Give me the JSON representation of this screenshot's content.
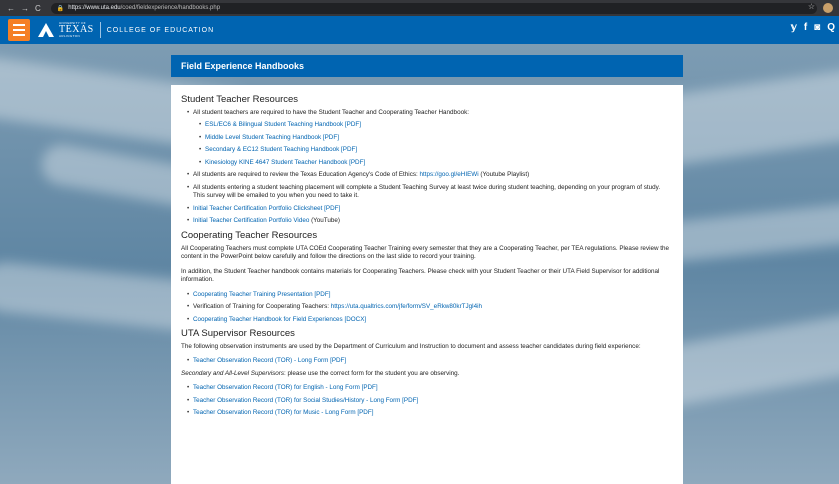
{
  "browser": {
    "url_host": "https://www.uta.edu",
    "url_path": "/coed/fieldexperience/handbooks.php"
  },
  "header": {
    "logo_university": "UNIVERSITY OF",
    "logo_texas": "TEXAS",
    "logo_arlington": "ARLINGTON",
    "college": "COLLEGE OF EDUCATION",
    "accent_color": "#0064b1",
    "menu_color": "#f58025",
    "social_icons": [
      "twitter-icon",
      "facebook-icon",
      "instagram-icon",
      "search-icon"
    ]
  },
  "page": {
    "title": "Field Experience Handbooks"
  },
  "student": {
    "heading": "Student Teacher Resources",
    "intro": "All student teachers are required to have the Student Teacher and Cooperating Teacher Handbook:",
    "handbooks": [
      "ESL/EC6 & Bilingual Student Teaching Handbook [PDF]",
      "Middle Level Student Teaching Handbook [PDF]",
      "Secondary & EC12 Student Teaching Handbook [PDF]",
      "Kinesiology KINE 4647 Student Teacher Handbook [PDF]"
    ],
    "ethics_text": "All students are required to review the Texas Education Agency's Code of Ethics: ",
    "ethics_link": "https://goo.gl/eHIEWi",
    "ethics_suffix": " (Youtube Playlist)",
    "survey_text": "All students entering a student teaching placement will complete a Student Teaching Survey at least twice during student teaching, depending on your program of study. This survey will be emailed to you when you need to take it.",
    "clicksheet": "Initial Teacher Certification Portfolio Clicksheet [PDF]",
    "video_link": "Initial Teacher Certification Portfolio Video",
    "video_suffix": " (YouTube)"
  },
  "cooperating": {
    "heading": "Cooperating Teacher Resources",
    "para1": "All Cooperating Teachers must complete UTA COEd Cooperating Teacher Training every semester that they are a Cooperating Teacher, per TEA regulations. Please review the content in the PowerPoint below carefully and follow the directions on the last slide to record your training.",
    "para2": "In addition, the Student Teacher handbook contains materials for Cooperating Teachers. Please check with your Student Teacher or their UTA Field Supervisor for additional information.",
    "presentation": "Cooperating Teacher Training Presentation [PDF]",
    "verification_text": "Verification of Training for Cooperating Teachers: ",
    "verification_link": "https://uta.qualtrics.com/jfe/form/SV_eRkw80krTJgl4ih",
    "handbook": "Cooperating Teacher Handbook for Field Experiences [DOCX]"
  },
  "supervisor": {
    "heading": "UTA Supervisor Resources",
    "para1": "The following observation instruments are used by the Department of Curriculum and Instruction to document and assess teacher candidates during field experience:",
    "tor": "Teacher Observation Record (TOR) - Long Form [PDF]",
    "note_em": "Secondary and All-Level Supervisors",
    "note_rest": ": please use the correct form for the student you are observing.",
    "tors": [
      "Teacher Observation Record (TOR) for English - Long Form [PDF]",
      "Teacher Observation Record (TOR) for Social Studies/History - Long Form [PDF]",
      "Teacher Observation Record (TOR) for Music - Long Form [PDF]"
    ]
  }
}
